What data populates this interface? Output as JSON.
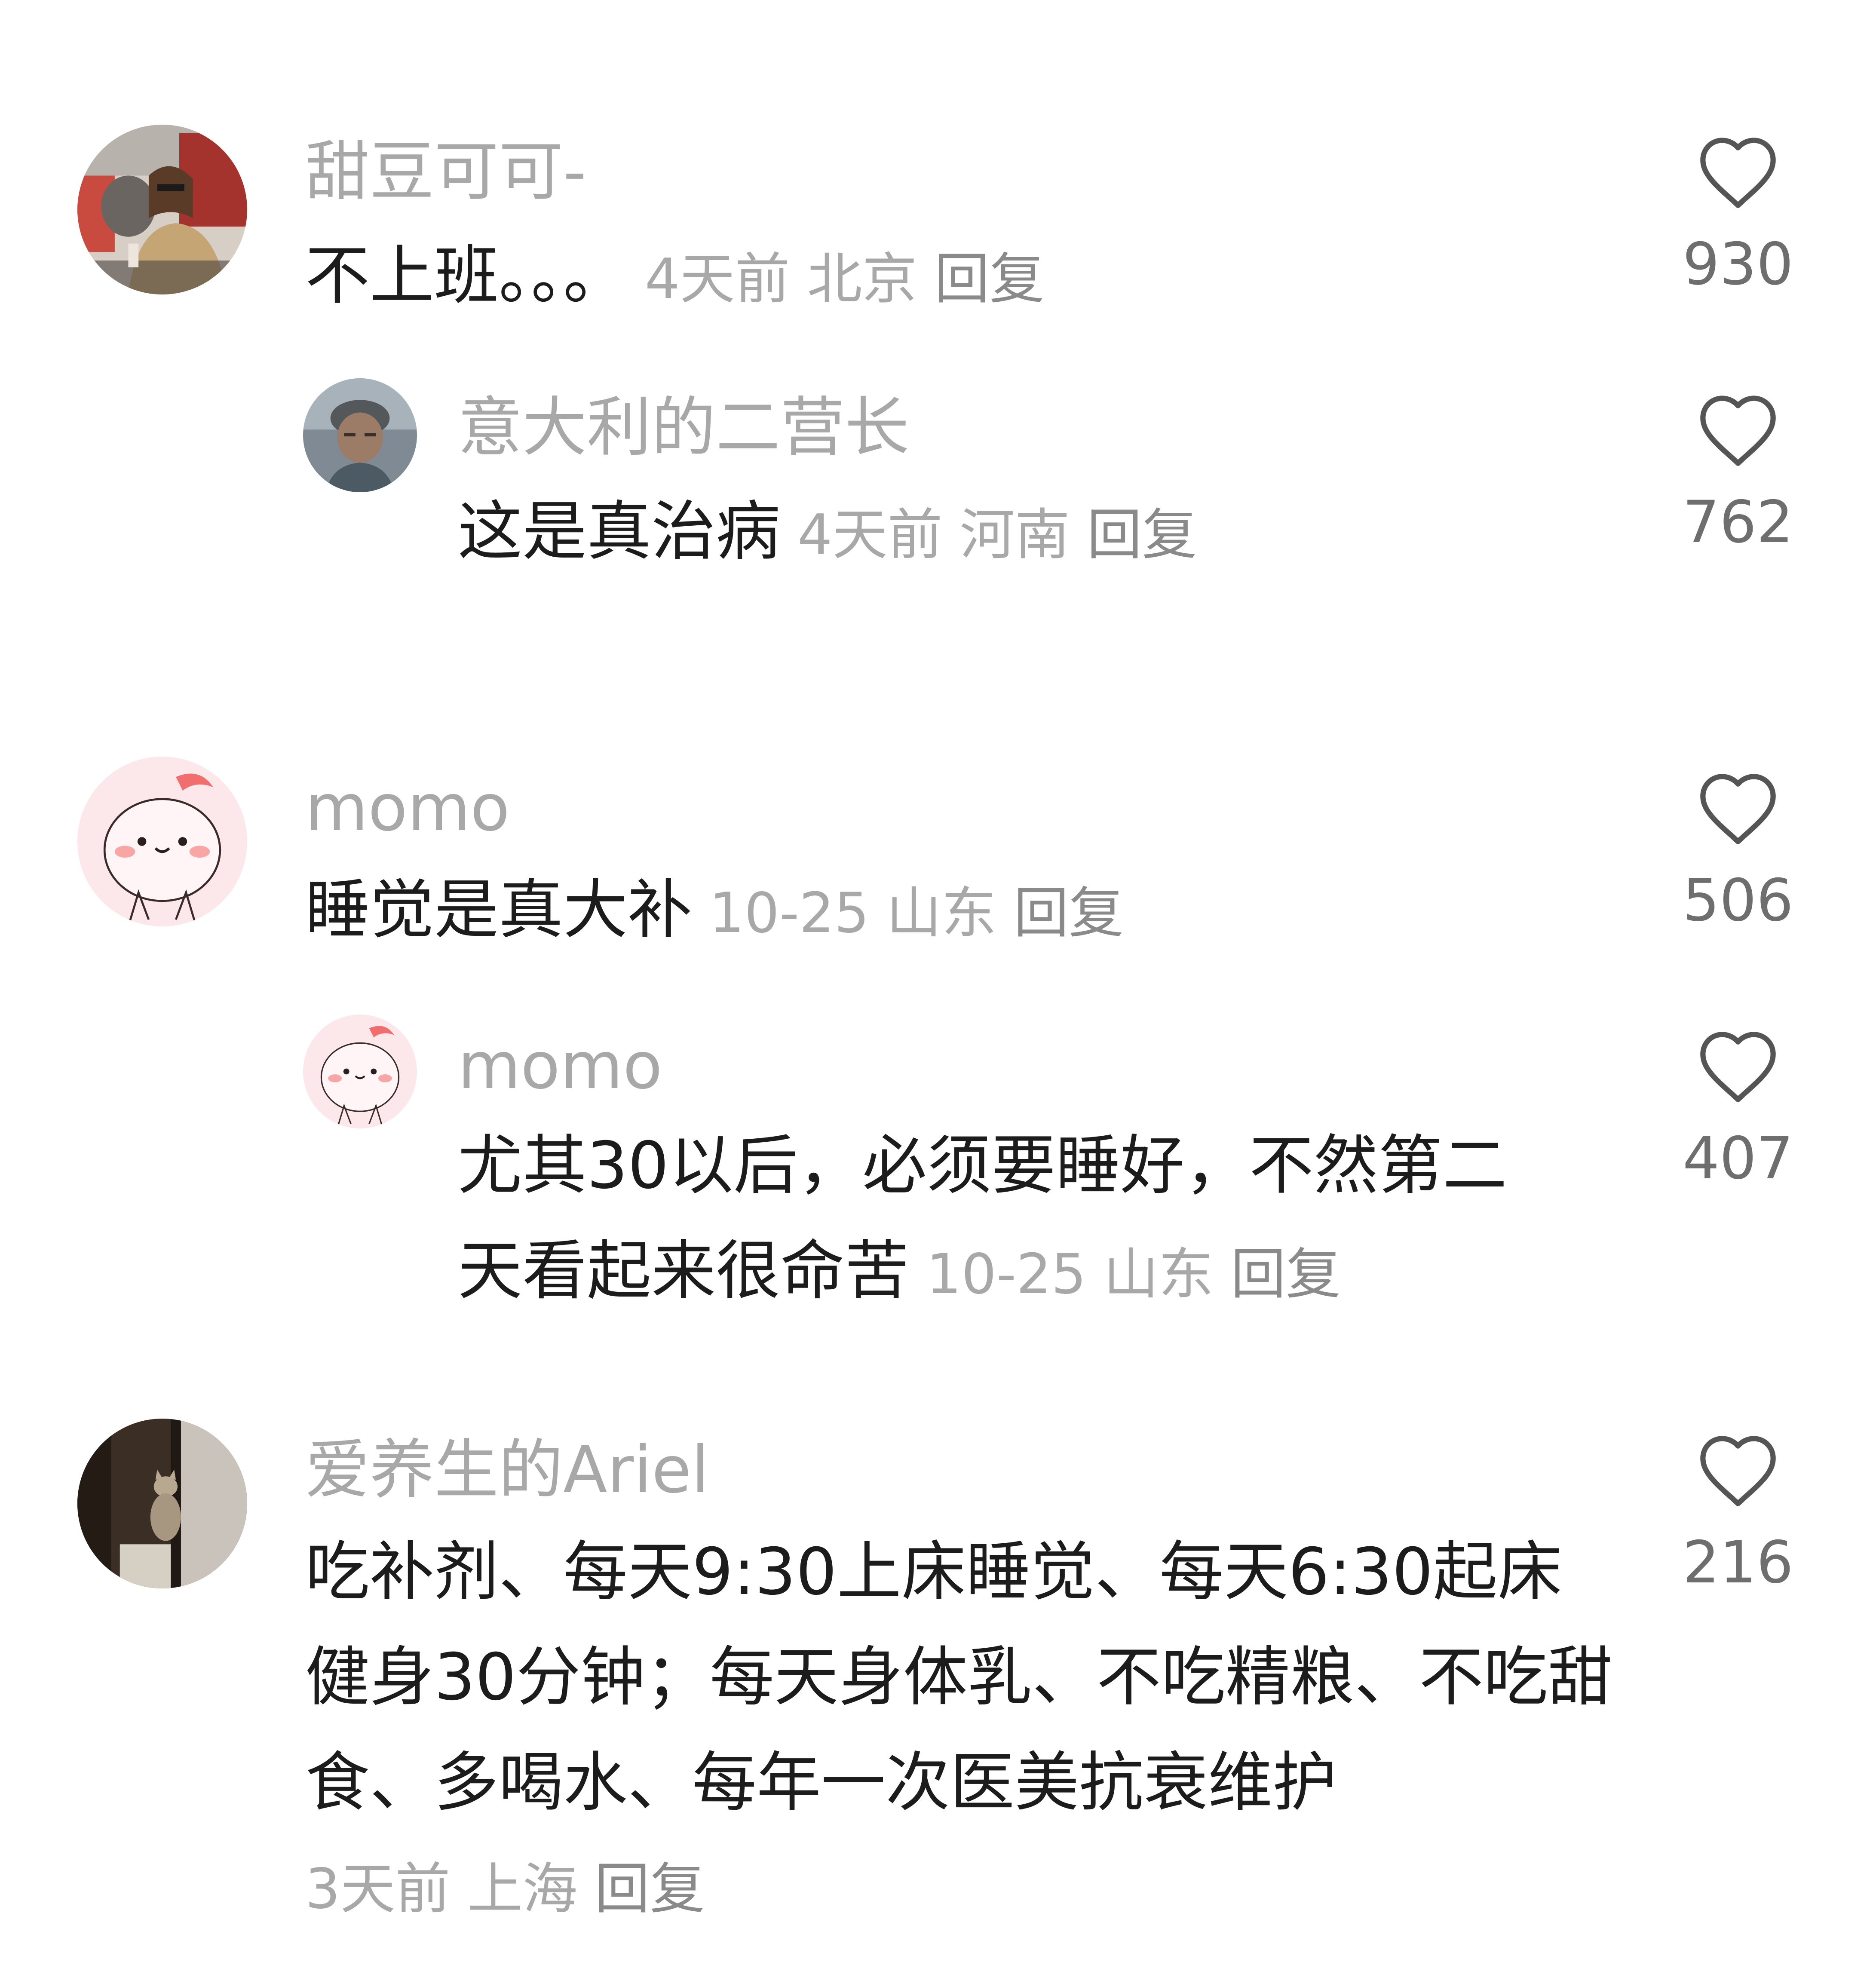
{
  "comments": [
    {
      "username": "甜豆可可-",
      "text": "不上班。。。",
      "time": "4天前",
      "location": "北京",
      "reply_label": "回复",
      "likes": "930",
      "avatar": "photo-avatar-woman",
      "replies": [
        {
          "username": "意大利的二营长",
          "text": "这是真治病",
          "time": "4天前",
          "location": "河南",
          "reply_label": "回复",
          "likes": "762",
          "avatar": "photo-avatar-man"
        }
      ]
    },
    {
      "username": "momo",
      "text": "睡觉是真大补",
      "time": "10-25",
      "location": "山东",
      "reply_label": "回复",
      "likes": "506",
      "avatar": "cartoon-peach-avatar",
      "replies": [
        {
          "username": "momo",
          "text": "尤其30以后，必须要睡好，不然第二天看起来很命苦",
          "time": "10-25",
          "location": "山东",
          "reply_label": "回复",
          "likes": "407",
          "avatar": "cartoon-peach-avatar"
        }
      ]
    },
    {
      "username": "爱养生的Ariel",
      "text": "吃补剂、每天9:30上床睡觉、每天6:30起床健身30分钟；每天身体乳、不吃精粮、不吃甜食、多喝水、每年一次医美抗衰维护",
      "time": "3天前",
      "location": "上海",
      "reply_label": "回复",
      "likes": "216",
      "avatar": "photo-avatar-cat",
      "replies": []
    }
  ],
  "colors": {
    "username": "#a8a8a8",
    "text": "#1c1c1c",
    "meta": "#a8a8a8",
    "like_icon": "#555555"
  },
  "icons": {
    "like": "heart-outline-icon"
  }
}
